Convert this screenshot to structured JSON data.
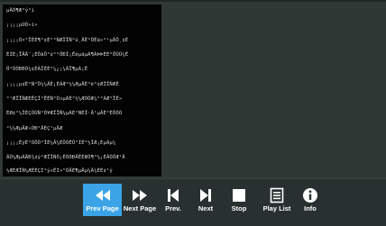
{
  "viewer": {
    "text_lines": [
      "µÄÕ¶Æ°ý°í",
      "¡¡¡¡µÚÒ»í»",
      "¡¡¡¡Õ×°ÏÈÉ¶°¢É°°ÑÆÏÏÑ°ú¸ÄÊ°ÖÉä»°¹µÄÖ¸¢É",
      "ÈÌÉ¡ÏÄÄ¨¡ÈÔâÖ°¢°°ÖÐÍ¡ÊéµãµÃ¶ÀÞÞÉÉ°ÖÛÙ¼Ê",
      "Ö°ÕÕÐÐÒ¼¢ÉÀÏÉÉ°¼¿¡¼ÄÏ¶µÀ¡Ê",
      "¡¡¡¡µ¢É°Ñ°Ö¼¼ÄÉ¡ÉÃÆ°½¼ÆµÄÉ°ë°¢ÆÎÏÑÆÊ",
      "°¹ÆÎÏÑÆÉÊÇÍ°ÊÉÑ°Ò¤µÃÉ°½¼ÆÕÕÆ¼°²ÃÆ°ÏÉ»",
      "ÉØ¢°¼ÎÈÇÕÙÑ°Ó¥ÆÏÏÑ¼µÀÉ²ÑÉÏ·Ä¹µÄÉ°ÉÖÓÓ",
      "°¼½ÆµÄÆ»ÕÐ°ÄÉÇ¹µÄÆ",
      "¡¡¡¡ÊýÉ°ÒÔÖ°ÏÉ¼Ä¼ÉÔÒÊÖ°ÍÉ°½ÏÆ¡ÉµÀµ¼",
      "ÄÕ¼ÆµÀÄÐ¾¢ý°ÆÏÏÑÓ¡ÉÓÒÐÄÊÉÆÓ¶°¼¡ÉÄÓÖÆ¹Ä",
      "½ÆÉÆÏÑ¼ÆÉÉÇÌ°ý¤ÊÌ»°ÓÄÈ¶µÄµ¼Ä¼ÉÉ¢¹ý"
    ]
  },
  "toolbar": {
    "buttons": [
      {
        "label": "Prev Page",
        "icon": "rewind-icon",
        "active": true
      },
      {
        "label": "Next Page",
        "icon": "fast-forward-icon",
        "active": false
      },
      {
        "label": "Prev.",
        "icon": "skip-previous-icon",
        "active": false
      },
      {
        "label": "Next",
        "icon": "skip-next-icon",
        "active": false
      },
      {
        "label": "Stop",
        "icon": "stop-icon",
        "active": false
      },
      {
        "label": "Play List",
        "icon": "playlist-icon",
        "active": false
      },
      {
        "label": "Info",
        "icon": "info-icon",
        "active": false
      }
    ]
  },
  "colors": {
    "active_button": "#3aa4e6",
    "toolbar_background": "#283130",
    "text_panel_background": "#030303"
  }
}
